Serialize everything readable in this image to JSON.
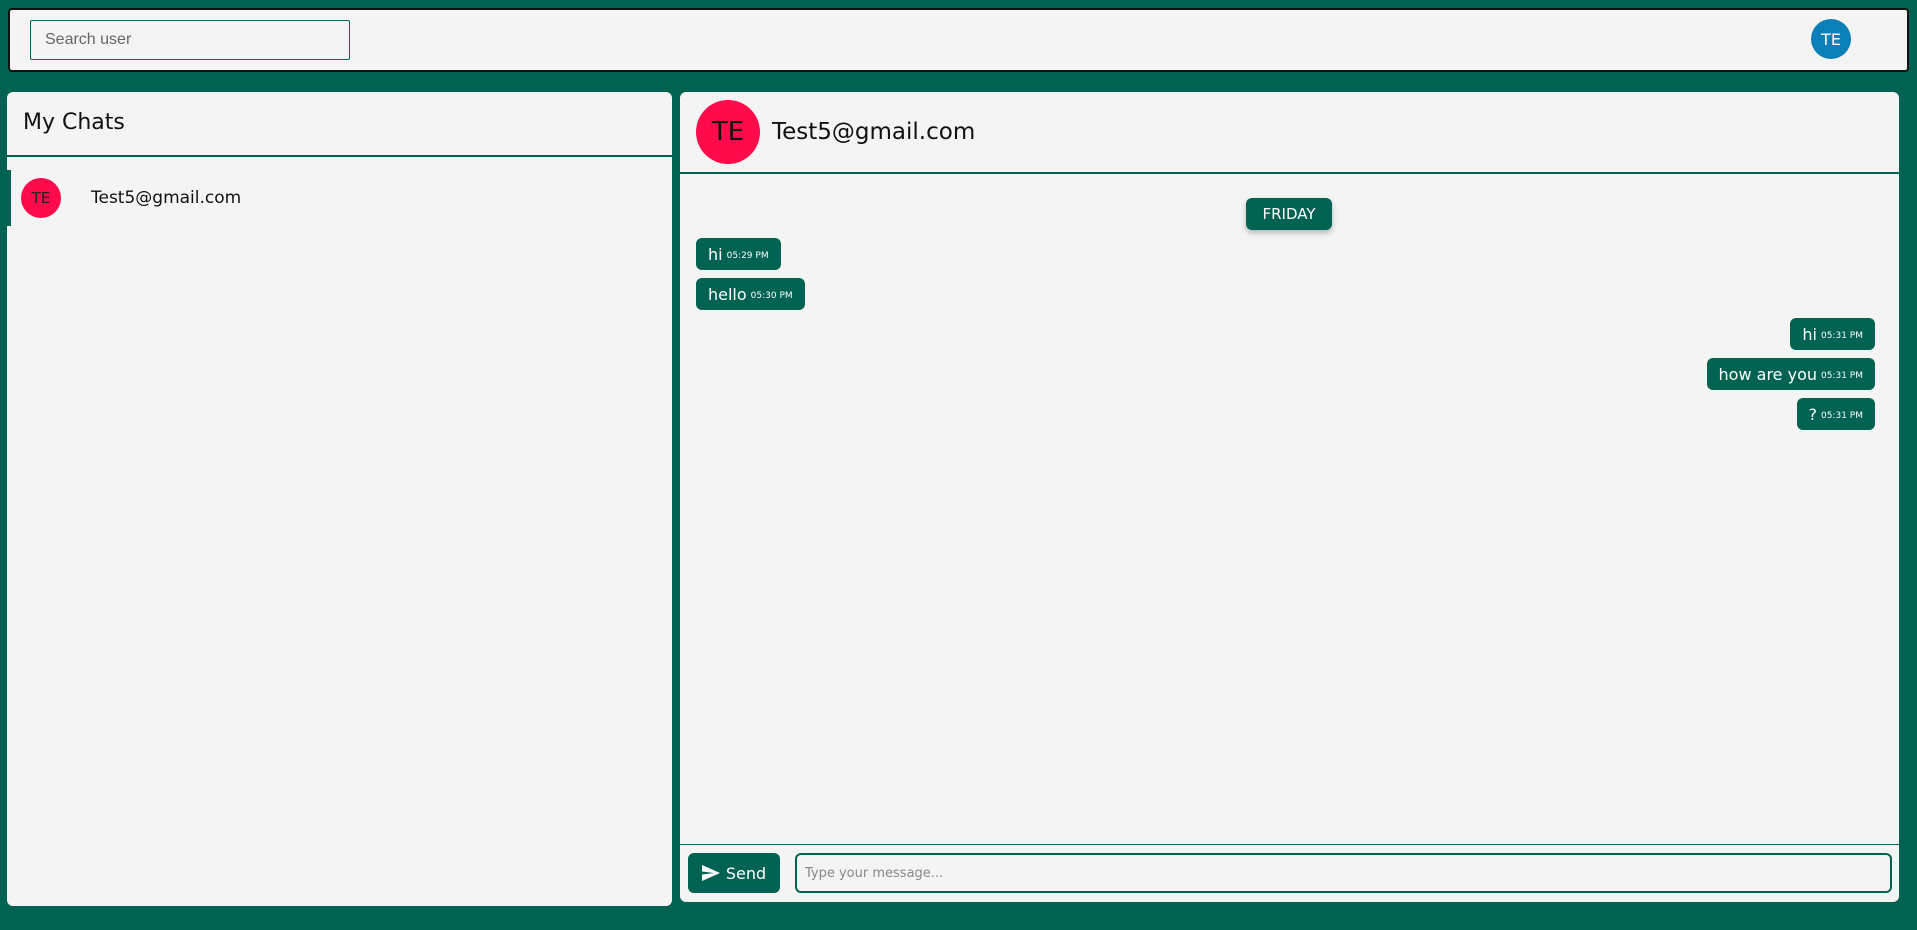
{
  "topbar": {
    "search_placeholder": "Search user",
    "user_initials": "TE"
  },
  "sidebar": {
    "title": "My Chats",
    "chats": [
      {
        "initials": "TE",
        "name": "Test5@gmail.com"
      }
    ]
  },
  "chat": {
    "header": {
      "initials": "TE",
      "name": "Test5@gmail.com"
    },
    "day_label": "FRIDAY",
    "messages": [
      {
        "text": "hi",
        "time": "05:29 PM",
        "side": "left"
      },
      {
        "text": "hello",
        "time": "05:30 PM",
        "side": "left"
      },
      {
        "text": "hi",
        "time": "05:31 PM",
        "side": "right"
      },
      {
        "text": "how are you",
        "time": "05:31 PM",
        "side": "right"
      },
      {
        "text": "?",
        "time": "05:31 PM",
        "side": "right"
      }
    ],
    "composer": {
      "send_label": "Send",
      "placeholder": "Type your message..."
    }
  },
  "colors": {
    "primary": "#006251",
    "avatar_contact": "#ff0a4b",
    "avatar_user": "#0a7fb8",
    "panel_bg": "#f4f4f4"
  }
}
